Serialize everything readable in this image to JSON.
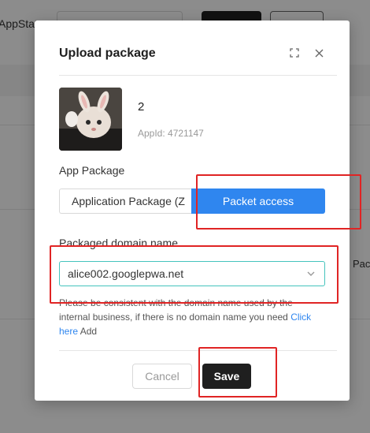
{
  "background": {
    "app_status_fragment": "AppStat",
    "row_fragment": "Pac"
  },
  "modal": {
    "title": "Upload package",
    "icons": {
      "expand": "expand-icon",
      "close": "close-icon"
    },
    "app": {
      "name": "2",
      "id_text": "AppId: 4721147"
    },
    "package_label": "App Package",
    "segments": [
      {
        "label": "Application Package (Z",
        "selected": false
      },
      {
        "label": "Packet access",
        "selected": true
      }
    ],
    "domain_label": "Packaged domain name",
    "domain_select": {
      "value": "alice002.googlepwa.net"
    },
    "hint": {
      "text_before": "Please be consistent with the domain name used by the internal business, if there is no domain name you need ",
      "link_text": "Click here",
      "text_after": " Add"
    },
    "buttons": {
      "cancel": "Cancel",
      "save": "Save"
    }
  },
  "colors": {
    "accent": "#2f86ef",
    "select_border": "#45c4bd",
    "save_bg": "#1f1f1f",
    "annotation": "#e02424"
  }
}
